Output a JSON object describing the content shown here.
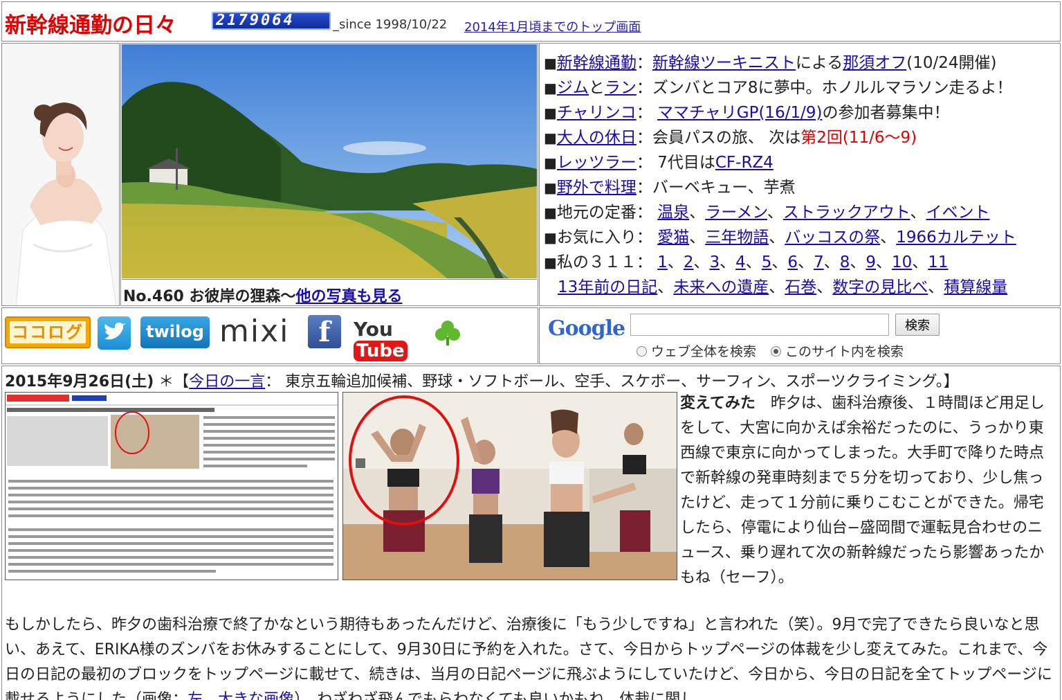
{
  "header": {
    "title": "新幹線通勤の日々",
    "counter": "2179064",
    "since": "_since 1998/10/22",
    "old_top_link": "2014年1月頃までのトップ画面"
  },
  "photo": {
    "number": "No.460 お彼岸の狸森〜",
    "more_link": "他の写真も見る"
  },
  "menu": {
    "l1": {
      "a": "新幹線通勤",
      "sep": "：",
      "b": "新幹線ツーキニスト",
      "t1": "による",
      "c": "那須オフ",
      "t2": "(10/24開催)"
    },
    "l2": {
      "a": "ジム",
      "t1": "と",
      "b": "ラン",
      "t2": "：ズンバとコア8に夢中。ホノルルマラソン走るよ！"
    },
    "l3": {
      "a": "チャリンコ",
      "t1": "：",
      "b": "ママチャリGP(16/1/9)",
      "t2": "の参加者募集中！"
    },
    "l4": {
      "a": "大人の休日",
      "t1": "：会員パスの旅、 次は",
      "red": "第2回(11/6〜9)"
    },
    "l5": {
      "a": "レッツラー",
      "t1": "： 7代目は",
      "b": "CF-RZ4"
    },
    "l6": {
      "a": "野外で料理",
      "t1": "：バーベキュー、芋煮"
    },
    "l7": {
      "t0": "地元の定番：",
      "a": "温泉",
      "b": "ラーメン",
      "c": "ストラックアウト",
      "d": "イベント",
      "sep": "、"
    },
    "l8": {
      "t0": "お気に入り：",
      "a": "愛猫",
      "b": "三年物語",
      "c": "バッコスの祭",
      "d": "1966カルテット",
      "sep": "、"
    },
    "l9": {
      "t0": "私の３１１：",
      "n1": "1",
      "n2": "2",
      "n3": "3",
      "n4": "4",
      "n5": "5",
      "n6": "6",
      "n7": "7",
      "n8": "8",
      "n9": "9",
      "n10": "10",
      "n11": "11",
      "sep": "、"
    },
    "l10": {
      "a": "13年前の日記",
      "b": "未来への遺産",
      "c": "石巻",
      "d": "数字の見比べ",
      "e": "積算線量",
      "sep": "、"
    },
    "bullet": "■"
  },
  "social": {
    "cocolog": "ココログ",
    "twilog": "twilog",
    "mixi": "mixi",
    "youtube_you": "You",
    "youtube_tube": "Tube"
  },
  "search": {
    "logo": "Google",
    "button": "検索",
    "option_web": "ウェブ全体を検索",
    "option_site": "このサイト内を検索"
  },
  "diary": {
    "date": "2015年9月26日(土)",
    "star": "＊【",
    "phrase_link": "今日の一言",
    "phrase": "： 東京五輪追加候補、野球・ソフトボール、空手、スケボー、サーフィン、スポーツクライミング。】",
    "side_title": "変えてみた",
    "side_text": "　昨夕は、歯科治療後、１時間ほど用足しをして、大宮に向かえば余裕だったのに、うっかり東西線で東京に向かってしまった。大手町で降りた時点で新幹線の発車時刻まで５分を切っており、少し焦ったけど、走って１分前に乗りこむことができた。帰宅したら、停電により仙台−盛岡間で運転見合わせのニュース、乗り遅れて次の新幹線だったら影響あったかもね（セーフ）。",
    "body_1": "もしかしたら、昨夕の歯科治療で終了かなという期待もあったんだけど、治療後に「もう少しですね」と言われた（笑）。9月で完了できたら良いなと思い、あえて、ERIKA様のズンバをお休みすることにして、9月30日に予約を入れた。さて、今日からトップページの体裁を少し変えてみた。これまで、今日の日記の最初のブロックをトップページに載せて、続きは、当月の日記ページに飛ぶようにしていたけど、今日から、今日の日記を全てトップページに載せるようにした（画像：",
    "body_link1": "左",
    "body_sep": "、",
    "body_link2": "大きな画像",
    "body_2": "）。わざわざ飛んでもらわなくても良いかもね。体裁に関し"
  }
}
